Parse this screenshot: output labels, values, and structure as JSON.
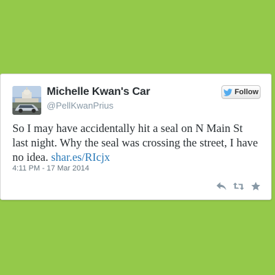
{
  "user": {
    "display_name": "Michelle Kwan's Car",
    "handle": "@PellKwanPrius"
  },
  "follow_button": {
    "label": "Follow"
  },
  "tweet": {
    "text": "So I may have accidentally hit a seal on N Main St last night. Why the seal was crossing the street, I have no idea.",
    "link": "shar.es/RIcjx",
    "timestamp": "4:11 PM - 17 Mar 2014"
  },
  "icons": {
    "avatar": "car-photo-avatar",
    "bird": "twitter-bird-icon",
    "reply": "reply-icon",
    "retweet": "retweet-icon",
    "favorite": "star-icon"
  },
  "colors": {
    "background": "#94c94a",
    "card": "#ffffff",
    "link": "#2b7bb9",
    "bird": "#55acee",
    "muted": "#8899a6"
  }
}
